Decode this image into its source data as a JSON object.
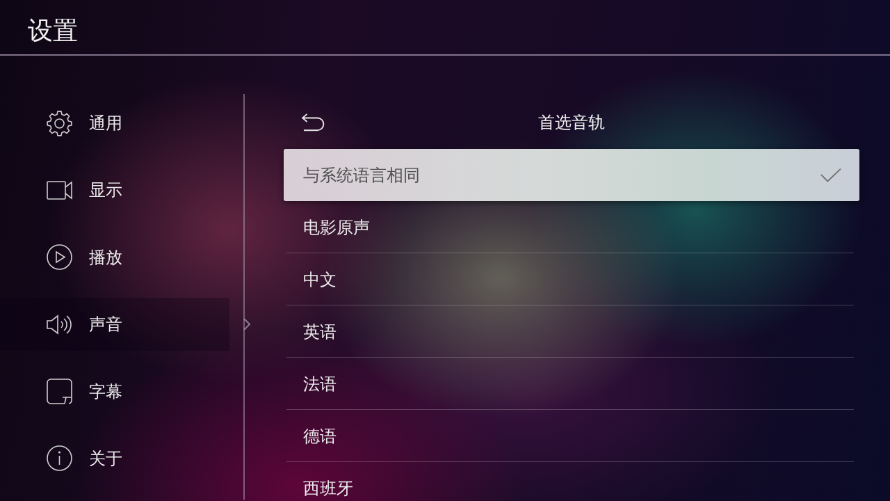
{
  "header": {
    "title": "设置"
  },
  "sidebar": {
    "items": [
      {
        "label": "通用",
        "selected": false
      },
      {
        "label": "显示",
        "selected": false
      },
      {
        "label": "播放",
        "selected": false
      },
      {
        "label": "声音",
        "selected": true
      },
      {
        "label": "字幕",
        "selected": false
      },
      {
        "label": "关于",
        "selected": false
      }
    ]
  },
  "panel": {
    "title": "首选音轨",
    "options": [
      {
        "label": "与系统语言相同",
        "selected": true,
        "checked": true
      },
      {
        "label": "电影原声",
        "selected": false,
        "checked": false
      },
      {
        "label": "中文",
        "selected": false,
        "checked": false
      },
      {
        "label": "英语",
        "selected": false,
        "checked": false
      },
      {
        "label": "法语",
        "selected": false,
        "checked": false
      },
      {
        "label": "德语",
        "selected": false,
        "checked": false
      },
      {
        "label": "西班牙",
        "selected": false,
        "checked": false
      }
    ]
  }
}
